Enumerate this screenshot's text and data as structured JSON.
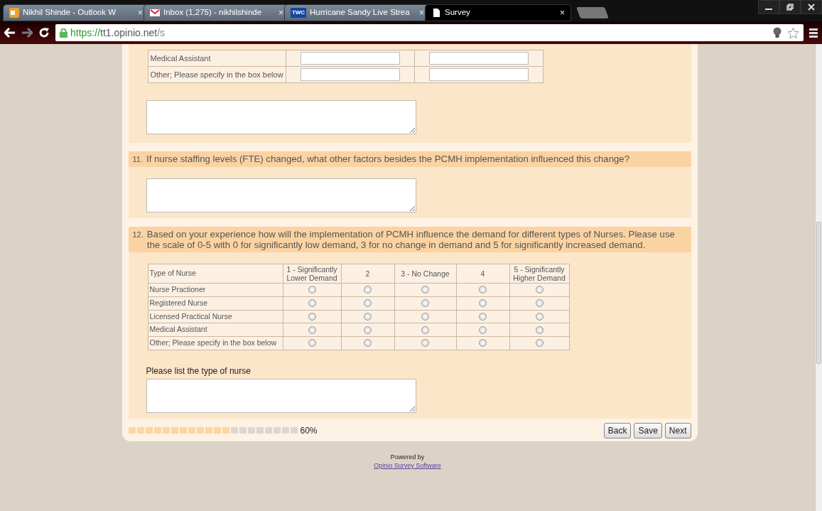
{
  "browser": {
    "tabs": [
      {
        "title": "Nikhil Shinde - Outlook W",
        "kind": "outlook",
        "close": "×",
        "selected": false
      },
      {
        "title": "Inbox (1,275) - nikhilshinde",
        "kind": "mail",
        "close": "×",
        "selected": false
      },
      {
        "title": "Hurricane Sandy Live Strea",
        "kind": "twc",
        "icon_text": "TWC",
        "close": "×",
        "selected": false
      },
      {
        "title": "Survey",
        "kind": "page",
        "close": "×",
        "selected": true
      }
    ],
    "url": {
      "scheme": "https://",
      "host": "tt1.opinio.net",
      "path": "/s"
    }
  },
  "question_10": {
    "rows": [
      {
        "label": "Medical Assistant"
      },
      {
        "label": "Other; Please specify in the box below"
      }
    ]
  },
  "question_11": {
    "number": "11.",
    "text": "If nurse staffing levels (FTE) changed, what other factors besides the PCMH implementation influenced this change?"
  },
  "question_12": {
    "number": "12.",
    "text": "Based on your experience how will the implementation of PCMH influence the demand for different types of Nurses. Please use the scale of 0-5 with 0 for significantly low  demand, 3 for no change in demand and 5 for significantly increased demand.",
    "columns": [
      "Type of Nurse",
      "1 - Significantly Lower Demand",
      "2",
      "3 - No Change",
      "4",
      "5 - Significantly Higher Demand"
    ],
    "rows": [
      {
        "label": "Nurse Practioner",
        "choices": [
          false,
          false,
          false,
          false,
          false
        ]
      },
      {
        "label": "Registered Nurse",
        "choices": [
          false,
          false,
          false,
          false,
          false
        ]
      },
      {
        "label": "Licensed Practical Nurse",
        "choices": [
          false,
          false,
          false,
          false,
          false
        ]
      },
      {
        "label": "Medical Assistant",
        "choices": [
          false,
          false,
          false,
          false,
          false
        ]
      },
      {
        "label": "Other; Please specify in the box below",
        "choices": [
          false,
          false,
          false,
          false,
          false
        ]
      }
    ],
    "other_label": "Please list the type of nurse"
  },
  "progress": {
    "level": 0.6,
    "reading": "60%"
  },
  "buttons": [
    "Back",
    "Save",
    "Next"
  ],
  "footer": {
    "powered_by": "Powered by",
    "link": "Opinio Survey Software"
  }
}
